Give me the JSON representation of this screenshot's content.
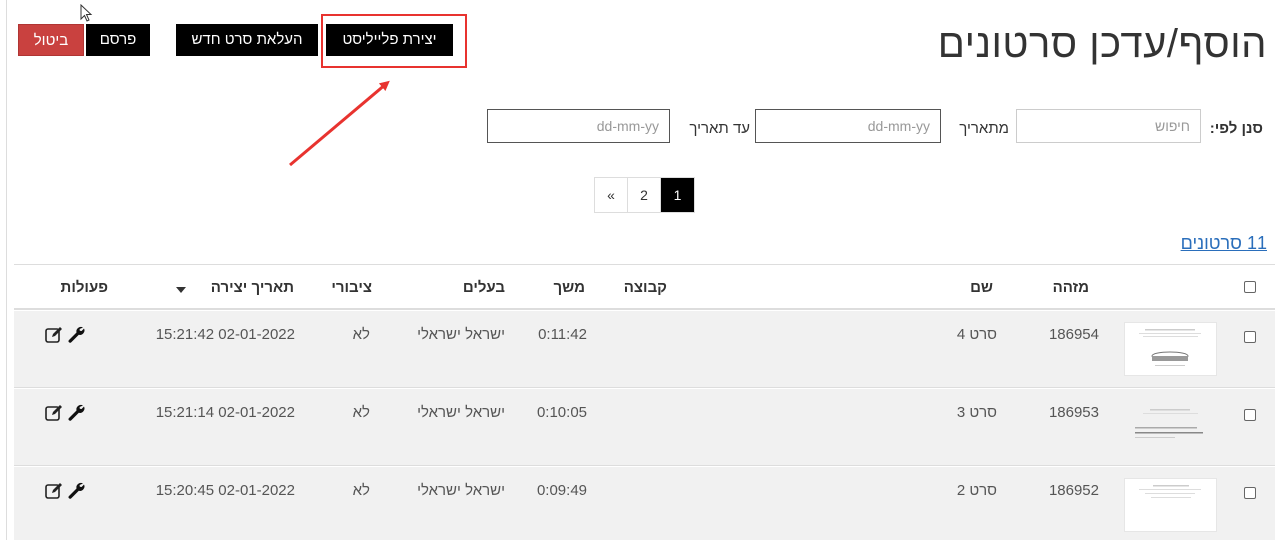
{
  "page": {
    "title": "הוסף/עדכן סרטונים"
  },
  "toolbar": {
    "cancel_label": "ביטול",
    "publish_label": "פרסם",
    "upload_label": "העלאת סרט חדש",
    "playlist_label": "יצירת פלייליסט"
  },
  "colors": {
    "cancel_bg": "#c9413f",
    "button_bg": "#000000",
    "highlight": "#e8332f",
    "link": "#2a6ebb",
    "row_bg": "#f1f1f1"
  },
  "filter": {
    "label": "סנן לפי:",
    "search_placeholder": "חיפוש",
    "from_label": "מתאריך",
    "from_placeholder": "dd-mm-yy",
    "to_label": "עד תאריך",
    "to_placeholder": "dd-mm-yy"
  },
  "pagination": {
    "prev": "«",
    "pages": [
      "2",
      "1"
    ],
    "active_page": "1"
  },
  "summary": {
    "count_label": "11 סרטונים"
  },
  "table": {
    "columns": {
      "id": "מזהה",
      "name": "שם",
      "group": "קבוצה",
      "duration": "משך",
      "owner": "בעלים",
      "public": "ציבורי",
      "created": "תאריך יצירה",
      "actions": "פעולות"
    },
    "sort_icon": "caret-down-icon",
    "rows": [
      {
        "id": "186954",
        "name": "סרט 4",
        "group": "",
        "duration": "0:11:42",
        "owner": "ישראל ישראלי",
        "public": "לא",
        "created": "15:21:42 02-01-2022"
      },
      {
        "id": "186953",
        "name": "סרט 3",
        "group": "",
        "duration": "0:10:05",
        "owner": "ישראל ישראלי",
        "public": "לא",
        "created": "15:21:14 02-01-2022"
      },
      {
        "id": "186952",
        "name": "סרט 2",
        "group": "",
        "duration": "0:09:49",
        "owner": "ישראל ישראלי",
        "public": "לא",
        "created": "15:20:45 02-01-2022"
      }
    ],
    "action_icons": [
      "wrench-icon",
      "edit-icon"
    ]
  }
}
